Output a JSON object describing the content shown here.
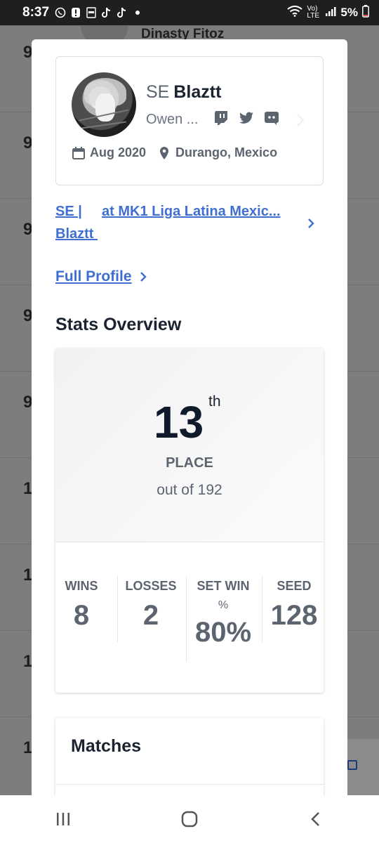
{
  "status_bar": {
    "time": "8:37",
    "icons": [
      "whatsapp-icon",
      "alert-icon",
      "pdf-icon",
      "tiktok-icon",
      "tiktok-icon",
      "dot-icon"
    ],
    "network": "Vo) LTE",
    "battery": "5%"
  },
  "background_list": {
    "top_name": "Dinasty Fitoz",
    "rows": [
      "9",
      "9",
      "9",
      "9",
      "9",
      "1",
      "1",
      "1",
      "1"
    ]
  },
  "profile": {
    "prefix": "SE",
    "gamer_tag": "Blaztt",
    "real_name": "Owen ...",
    "socials": [
      "twitch-icon",
      "twitter-icon",
      "discord-icon"
    ],
    "joined": "Aug 2020",
    "location": "Durango, Mexico"
  },
  "event_link": {
    "prefix": "SE |",
    "gamer": "Blaztt ",
    "event": "at MK1 Liga Latina Mexic..."
  },
  "full_profile": {
    "label": "Full Profile"
  },
  "stats": {
    "section_title": "Stats Overview",
    "place": "13",
    "place_suffix": "th",
    "place_label": "PLACE",
    "out_of": "out of 192",
    "wins_label": "WINS",
    "wins": "8",
    "losses_label": "LOSSES",
    "losses": "2",
    "setwin_label_1": "SET WIN",
    "setwin_label_2": "%",
    "setwin": "80%",
    "seed_label": "SEED",
    "seed": "128"
  },
  "matches": {
    "title": "Matches"
  }
}
